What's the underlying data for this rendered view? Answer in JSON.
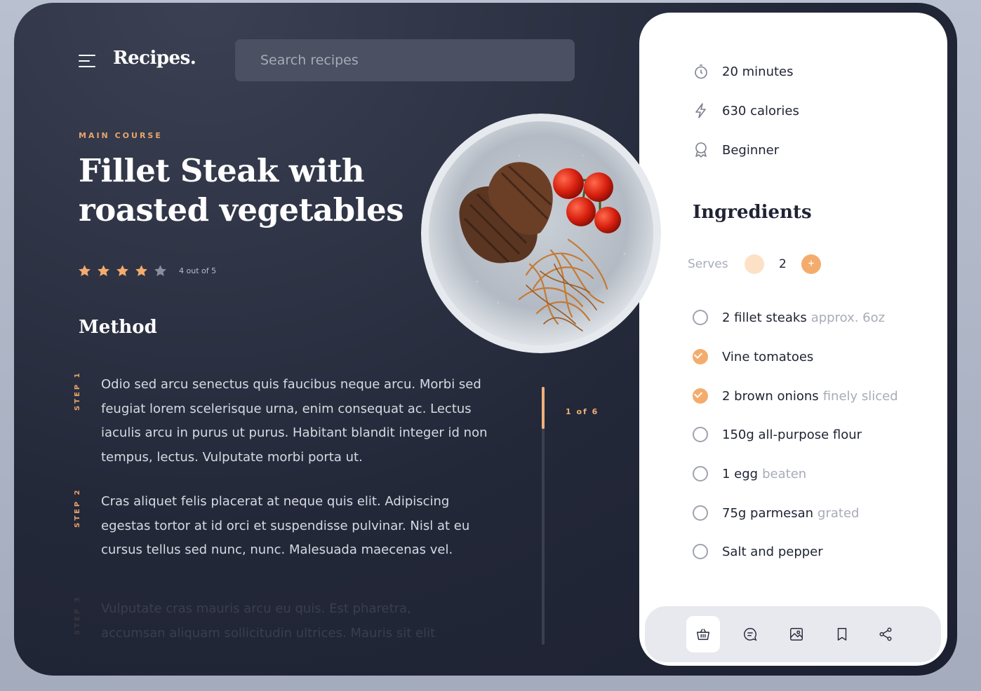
{
  "header": {
    "brand": "Recipes.",
    "search_placeholder": "Search recipes"
  },
  "recipe": {
    "category": "MAIN COURSE",
    "title_line1": "Fillet Steak with",
    "title_line2": "roasted vegetables",
    "rating": {
      "value": 4,
      "max": 5,
      "text": "4 out of 5"
    },
    "method_heading": "Method",
    "steps": [
      {
        "label": "STEP 1",
        "text": "Odio sed arcu senectus quis faucibus neque arcu. Morbi sed feugiat lorem scelerisque urna, enim consequat ac. Lectus iaculis arcu in purus ut purus. Habitant blandit integer id non tempus, lectus. Vulputate morbi porta ut."
      },
      {
        "label": "STEP 2",
        "text": "Cras aliquet felis placerat at neque quis elit. Adipiscing egestas tortor at id orci et suspendisse pulvinar. Nisl at eu cursus tellus sed nunc, nunc. Malesuada maecenas vel."
      },
      {
        "label": "STEP 3",
        "text": "Vulputate cras mauris arcu eu quis. Est pharetra, accumsan aliquam sollicitudin ultrices. Mauris sit elit"
      }
    ],
    "page_indicator": "1 of 6"
  },
  "details": {
    "time": "20 minutes",
    "calories": "630 calories",
    "difficulty": "Beginner"
  },
  "ingredients": {
    "heading": "Ingredients",
    "serves_label": "Serves",
    "serves_value": "2",
    "plus_label": "+",
    "items": [
      {
        "name": "2 fillet steaks",
        "note": "approx. 6oz",
        "checked": false
      },
      {
        "name": "Vine tomatoes",
        "note": "",
        "checked": true
      },
      {
        "name": "2 brown onions",
        "note": "finely sliced",
        "checked": true
      },
      {
        "name": "150g all-purpose flour",
        "note": "",
        "checked": false
      },
      {
        "name": "1 egg",
        "note": "beaten",
        "checked": false
      },
      {
        "name": "75g parmesan",
        "note": "grated",
        "checked": false
      },
      {
        "name": "Salt and pepper",
        "note": "",
        "checked": false
      }
    ]
  },
  "toolbar": {
    "items": [
      "basket-icon",
      "comment-icon",
      "image-icon",
      "bookmark-icon",
      "share-icon"
    ],
    "active": "basket-icon"
  },
  "colors": {
    "accent": "#f4ac6d",
    "dark_bg": "#232839",
    "panel_bg": "#ffffff"
  }
}
